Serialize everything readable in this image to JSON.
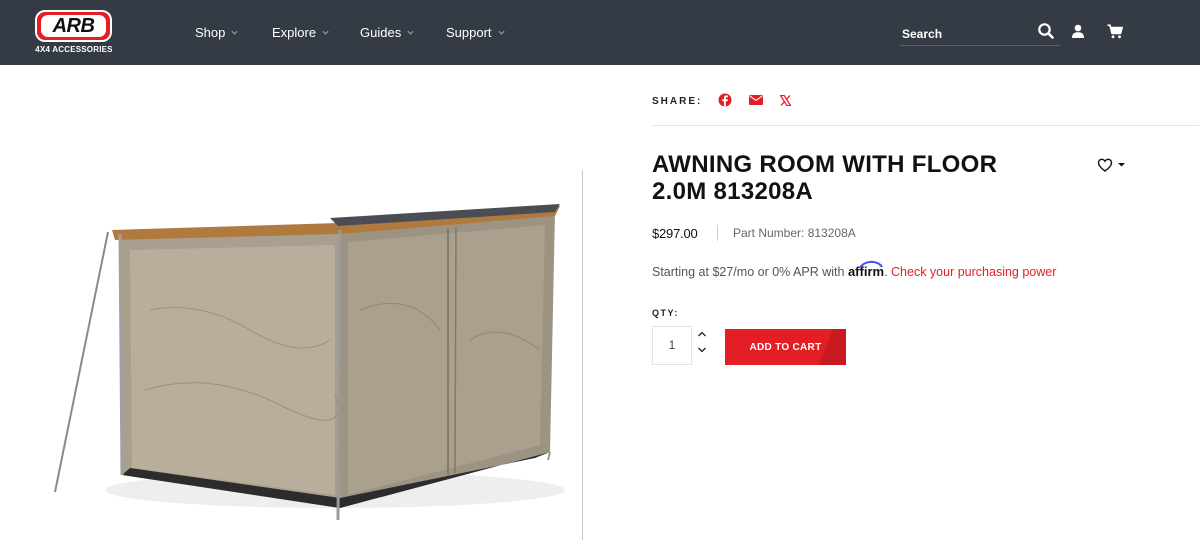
{
  "header": {
    "logo_text": "ARB",
    "logo_subtext": "4X4 ACCESSORIES",
    "nav": [
      {
        "label": "Shop"
      },
      {
        "label": "Explore"
      },
      {
        "label": "Guides"
      },
      {
        "label": "Support"
      }
    ],
    "search_placeholder": "Search",
    "icons": [
      "search-icon",
      "account-icon",
      "cart-icon"
    ]
  },
  "product": {
    "image_alt": "awning room tent",
    "share_label": "SHARE:",
    "share_icons": [
      "facebook-icon",
      "email-icon",
      "x-icon"
    ],
    "title_line1": "AWNING ROOM WITH FLOOR",
    "title_line2": "2.0M 813208A",
    "price": "$297.00",
    "part_number_label": "Part Number:",
    "part_number": "813208A",
    "affirm_prefix": "Starting at $27/mo or 0% APR with",
    "affirm_brand": "affirm",
    "affirm_link": "Check your purchasing power",
    "qty_label": "QTY:",
    "qty_value": "1",
    "add_to_cart": "ADD TO CART"
  },
  "colors": {
    "header_bg": "#353b45",
    "accent": "#e31e24",
    "text": "#111111"
  }
}
